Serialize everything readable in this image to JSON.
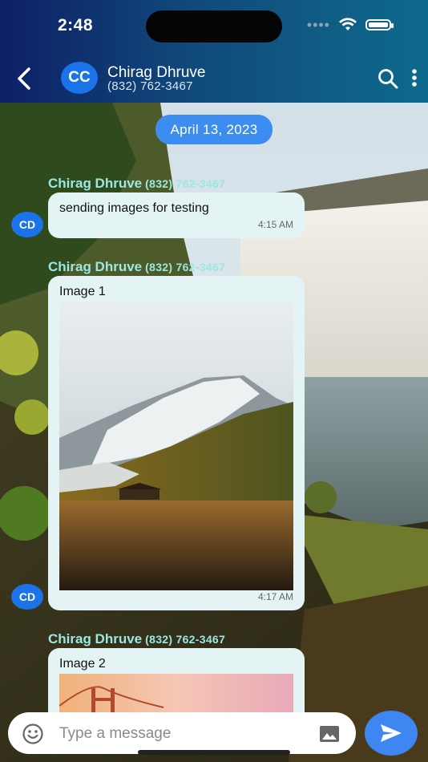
{
  "status_bar": {
    "time": "2:48"
  },
  "header": {
    "avatar_initials": "CC",
    "contact_name": "Chirag Dhruve",
    "contact_phone": "(832) 762-3467"
  },
  "date_divider": "April 13, 2023",
  "messages": [
    {
      "sender_name": "Chirag Dhruve",
      "sender_phone": "(832) 762-3467",
      "text": "sending images for testing",
      "time": "4:15 AM",
      "avatar_initials": "CD"
    },
    {
      "sender_name": "Chirag Dhruve",
      "sender_phone": "(832) 762-3467",
      "image_title": "Image 1",
      "time": "4:17 AM",
      "avatar_initials": "CD"
    },
    {
      "sender_name": "Chirag Dhruve",
      "sender_phone": "(832) 762-3467",
      "image_title": "Image 2"
    }
  ],
  "composer": {
    "placeholder": "Type a message"
  },
  "icons": {
    "back": "chevron-left-icon",
    "search": "search-icon",
    "more": "more-vertical-icon",
    "emoji": "emoji-icon",
    "attach": "image-icon",
    "send": "send-icon"
  },
  "colors": {
    "accent": "#3e86f2",
    "avatar": "#1a73e8",
    "sender_name": "#9be8e0",
    "bubble": "#e4f4f4"
  }
}
